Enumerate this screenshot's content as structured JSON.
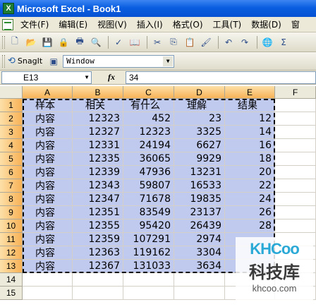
{
  "window": {
    "title": "Microsoft Excel - Book1",
    "app_icon_glyph": "X"
  },
  "menu": [
    "文件(F)",
    "编辑(E)",
    "视图(V)",
    "插入(I)",
    "格式(O)",
    "工具(T)",
    "数据(D)",
    "窗"
  ],
  "toolbar": {
    "snagit_label": "SnagIt",
    "window_select_value": "Window"
  },
  "formula_bar": {
    "name_box": "E13",
    "fx": "fx",
    "value": "34"
  },
  "columns": [
    "A",
    "B",
    "C",
    "D",
    "E",
    "F"
  ],
  "row_numbers": [
    "1",
    "2",
    "3",
    "4",
    "5",
    "6",
    "7",
    "8",
    "9",
    "10",
    "11",
    "12",
    "13",
    "14",
    "15"
  ],
  "header_row": [
    "样本",
    "相关",
    "有什么",
    "理解",
    "结果"
  ],
  "data_rows": [
    [
      "内容",
      "12323",
      "452",
      "23",
      "12"
    ],
    [
      "内容",
      "12327",
      "12323",
      "3325",
      "14"
    ],
    [
      "内容",
      "12331",
      "24194",
      "6627",
      "16"
    ],
    [
      "内容",
      "12335",
      "36065",
      "9929",
      "18"
    ],
    [
      "内容",
      "12339",
      "47936",
      "13231",
      "20"
    ],
    [
      "内容",
      "12343",
      "59807",
      "16533",
      "22"
    ],
    [
      "内容",
      "12347",
      "71678",
      "19835",
      "24"
    ],
    [
      "内容",
      "12351",
      "83549",
      "23137",
      "26"
    ],
    [
      "内容",
      "12355",
      "95420",
      "26439",
      "28"
    ],
    [
      "内容",
      "12359",
      "107291",
      "2974",
      ""
    ],
    [
      "内容",
      "12363",
      "119162",
      "3304",
      ""
    ],
    [
      "内容",
      "12367",
      "131033",
      "3634",
      ""
    ]
  ],
  "watermark": {
    "logo": "KHCoo",
    "cn": "科技库",
    "url": "khcoo.com"
  },
  "colors": {
    "accent": "#0a5ee0",
    "header_selected": "#f8b257",
    "selection_fill": "#c0c9ee"
  }
}
